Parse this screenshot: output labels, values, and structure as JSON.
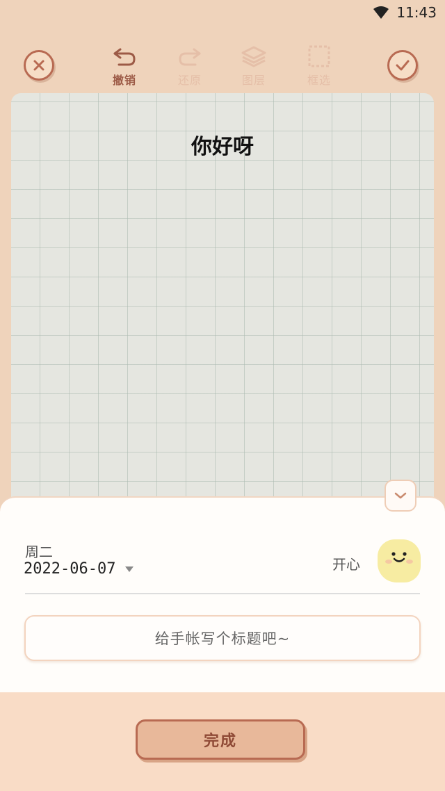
{
  "status_bar": {
    "time": "11:43",
    "icons": [
      "wifi-icon"
    ]
  },
  "toolbar": {
    "close_icon": "close-icon",
    "confirm_icon": "check-icon",
    "tools": [
      {
        "icon": "undo-icon",
        "label": "撤销",
        "active": true
      },
      {
        "icon": "redo-icon",
        "label": "还原",
        "active": false
      },
      {
        "icon": "layers-icon",
        "label": "图层",
        "active": false
      },
      {
        "icon": "marquee-select-icon",
        "label": "框选",
        "active": false
      }
    ]
  },
  "canvas": {
    "text": "你好呀"
  },
  "sheet": {
    "collapse_icon": "chevron-down-icon",
    "weekday": "周二",
    "date": "2022-06-07",
    "mood": {
      "label": "开心",
      "icon": "happy-face-icon"
    },
    "title_placeholder": "给手帐写个标题吧~"
  },
  "footer": {
    "done_label": "完成"
  },
  "colors": {
    "background": "#efd3bb",
    "accent_brown": "#b86a52",
    "sheet": "#fffdfa",
    "done_button": "#e8b89a",
    "mood_face": "#f7eca2"
  }
}
